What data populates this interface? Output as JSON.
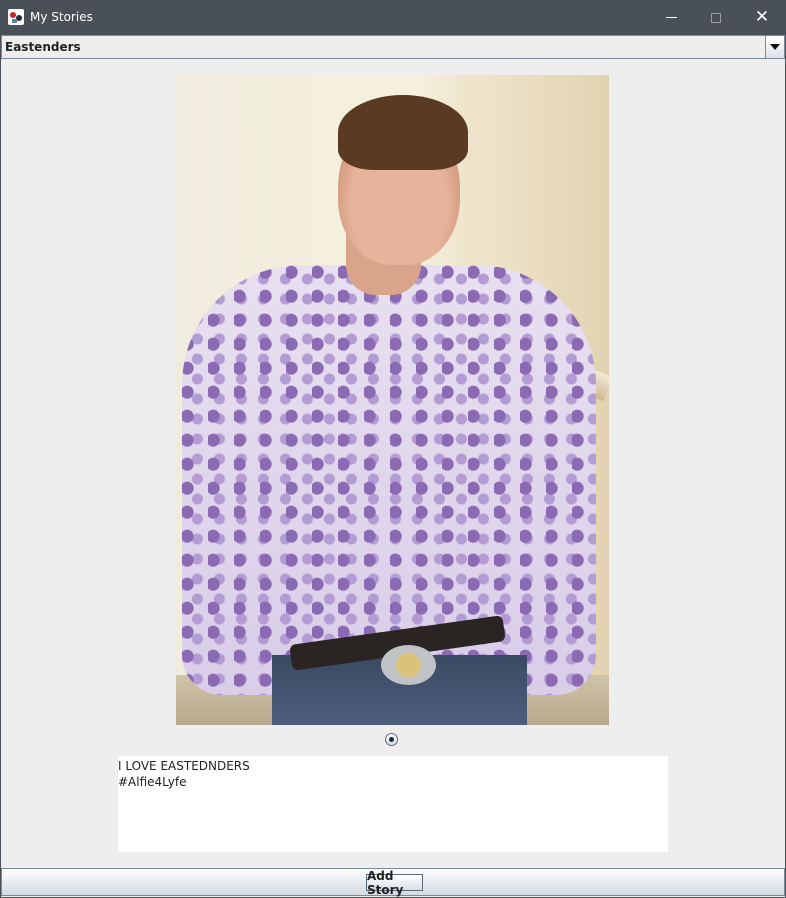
{
  "window": {
    "title": "My Stories"
  },
  "story_selector": {
    "selected": "Eastenders"
  },
  "story": {
    "lines": [
      "I LOVE EASTEDNDERS",
      "#Alfie4Lyfe"
    ],
    "selected_index": 0
  },
  "actions": {
    "add_story_label": "Add Story"
  }
}
